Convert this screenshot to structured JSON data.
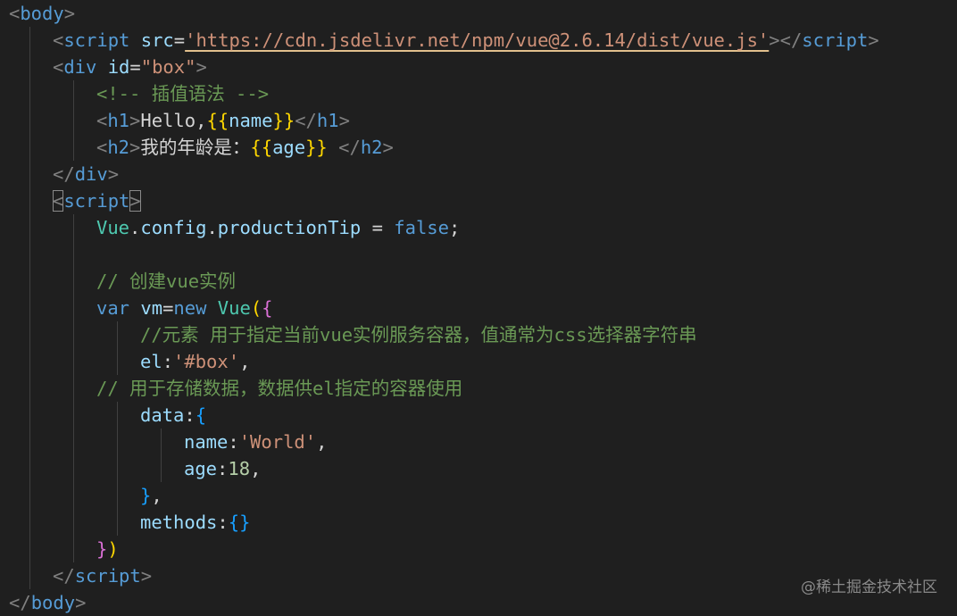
{
  "theme": {
    "background": "#1f1f1f",
    "tag": "#569cd6",
    "punct": "#808080",
    "attr": "#9cdcfe",
    "string": "#ce9178",
    "comment": "#6a9955",
    "text": "#d4d4d4",
    "keyword": "#569cd6",
    "class": "#4ec9b0",
    "number": "#b5cea8",
    "brace_gold": "#ffd700",
    "brace_violet": "#da70d6",
    "brace_blue": "#179fff",
    "property": "#9cdcfe"
  },
  "code": {
    "lines": [
      {
        "indent": 0,
        "tokens": [
          [
            "<",
            "punct"
          ],
          [
            "body",
            "tag"
          ],
          [
            ">",
            "punct"
          ]
        ]
      },
      {
        "indent": 1,
        "tokens": [
          [
            "<",
            "punct"
          ],
          [
            "script",
            "tag"
          ],
          [
            " ",
            "text"
          ],
          [
            "src",
            "attr"
          ],
          [
            "=",
            "text"
          ],
          [
            "'https://cdn.jsdelivr.net/npm/vue@2.6.14/dist/vue.js'",
            "string",
            "squiggle"
          ],
          [
            "></",
            "punct"
          ],
          [
            "script",
            "tag"
          ],
          [
            ">",
            "punct"
          ]
        ]
      },
      {
        "indent": 1,
        "tokens": [
          [
            "<",
            "punct"
          ],
          [
            "div",
            "tag"
          ],
          [
            " ",
            "text"
          ],
          [
            "id",
            "attr"
          ],
          [
            "=",
            "text"
          ],
          [
            "\"box\"",
            "string"
          ],
          [
            ">",
            "punct"
          ]
        ]
      },
      {
        "indent": 2,
        "tokens": [
          [
            "<!-- 插值语法 -->",
            "comment"
          ]
        ]
      },
      {
        "indent": 2,
        "tokens": [
          [
            "<",
            "punct"
          ],
          [
            "h1",
            "tag"
          ],
          [
            ">",
            "punct"
          ],
          [
            "Hello,",
            "text"
          ],
          [
            "{{",
            "brace_gold"
          ],
          [
            "name",
            "attr"
          ],
          [
            "}}",
            "brace_gold"
          ],
          [
            "</",
            "punct"
          ],
          [
            "h1",
            "tag"
          ],
          [
            ">",
            "punct"
          ]
        ]
      },
      {
        "indent": 2,
        "tokens": [
          [
            "<",
            "punct"
          ],
          [
            "h2",
            "tag"
          ],
          [
            ">",
            "punct"
          ],
          [
            "我的年龄是：",
            "text"
          ],
          [
            "{{",
            "brace_gold"
          ],
          [
            "age",
            "attr"
          ],
          [
            "}}",
            "brace_gold"
          ],
          [
            " ",
            "text"
          ],
          [
            "</",
            "punct"
          ],
          [
            "h2",
            "tag"
          ],
          [
            ">",
            "punct"
          ]
        ]
      },
      {
        "indent": 1,
        "tokens": [
          [
            "</",
            "punct"
          ],
          [
            "div",
            "tag"
          ],
          [
            ">",
            "punct"
          ]
        ]
      },
      {
        "indent": 1,
        "tokens": [
          [
            "<",
            "punct",
            "bracket-hl"
          ],
          [
            "script",
            "tag"
          ],
          [
            ">",
            "punct",
            "bracket-hl"
          ]
        ]
      },
      {
        "indent": 2,
        "tokens": [
          [
            "Vue",
            "class"
          ],
          [
            ".",
            "text"
          ],
          [
            "config",
            "property"
          ],
          [
            ".",
            "text"
          ],
          [
            "productionTip",
            "property"
          ],
          [
            " = ",
            "text"
          ],
          [
            "false",
            "keyword"
          ],
          [
            ";",
            "text"
          ]
        ]
      },
      {
        "indent": 0,
        "tokens": []
      },
      {
        "indent": 2,
        "tokens": [
          [
            "// 创建vue实例",
            "comment"
          ]
        ]
      },
      {
        "indent": 2,
        "tokens": [
          [
            "var",
            "keyword"
          ],
          [
            " ",
            "text"
          ],
          [
            "vm",
            "property"
          ],
          [
            "=",
            "text"
          ],
          [
            "new",
            "keyword"
          ],
          [
            " ",
            "text"
          ],
          [
            "Vue",
            "class"
          ],
          [
            "(",
            "brace_gold"
          ],
          [
            "{",
            "brace_violet"
          ]
        ]
      },
      {
        "indent": 3,
        "tokens": [
          [
            "//元素 用于指定当前vue实例服务容器，值通常为css选择器字符串",
            "comment"
          ]
        ]
      },
      {
        "indent": 3,
        "tokens": [
          [
            "el",
            "property"
          ],
          [
            ":",
            "text"
          ],
          [
            "'#box'",
            "string"
          ],
          [
            ",",
            "text"
          ]
        ]
      },
      {
        "indent": 2,
        "tokens": [
          [
            "// 用于存储数据，数据供el指定的容器使用",
            "comment"
          ]
        ]
      },
      {
        "indent": 3,
        "tokens": [
          [
            "data",
            "property"
          ],
          [
            ":",
            "text"
          ],
          [
            "{",
            "brace_blue"
          ]
        ]
      },
      {
        "indent": 4,
        "tokens": [
          [
            "name",
            "property"
          ],
          [
            ":",
            "text"
          ],
          [
            "'World'",
            "string"
          ],
          [
            ",",
            "text"
          ]
        ]
      },
      {
        "indent": 4,
        "tokens": [
          [
            "age",
            "property"
          ],
          [
            ":",
            "text"
          ],
          [
            "18",
            "number"
          ],
          [
            ",",
            "text"
          ]
        ]
      },
      {
        "indent": 3,
        "tokens": [
          [
            "}",
            "brace_blue"
          ],
          [
            ",",
            "text"
          ]
        ]
      },
      {
        "indent": 3,
        "tokens": [
          [
            "methods",
            "property"
          ],
          [
            ":",
            "text"
          ],
          [
            "{}",
            "brace_blue"
          ]
        ]
      },
      {
        "indent": 2,
        "tokens": [
          [
            "}",
            "brace_violet"
          ],
          [
            ")",
            "brace_gold"
          ]
        ]
      },
      {
        "indent": 1,
        "tokens": [
          [
            "</",
            "punct"
          ],
          [
            "script",
            "tag"
          ],
          [
            ">",
            "punct"
          ]
        ]
      },
      {
        "indent": 0,
        "tokens": [
          [
            "</",
            "punct"
          ],
          [
            "body",
            "tag"
          ],
          [
            ">",
            "punct"
          ]
        ]
      }
    ]
  },
  "watermark": "@稀土掘金技术社区"
}
